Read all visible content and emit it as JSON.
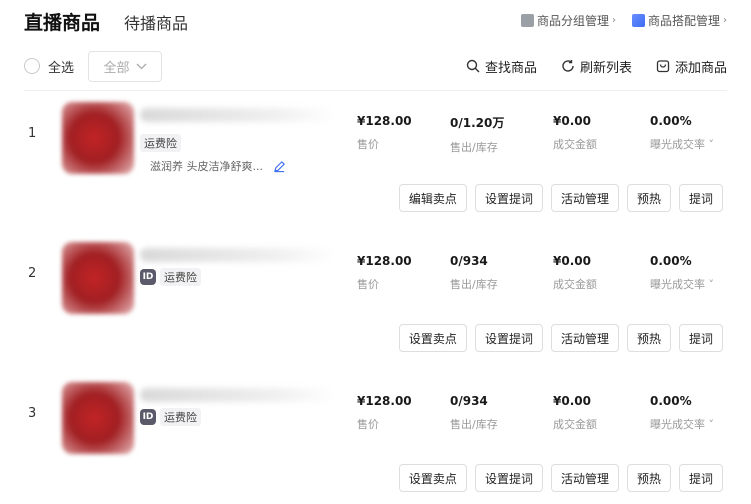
{
  "tabs": {
    "active": "直播商品",
    "inactive": "待播商品"
  },
  "top_links": {
    "group_manage": "商品分组管理",
    "match_manage": "商品搭配管理"
  },
  "toolbar": {
    "select_all": "全选",
    "filter_value": "全部",
    "find": "查找商品",
    "refresh": "刷新列表",
    "add": "添加商品"
  },
  "rows": [
    {
      "index": "1",
      "tag": "运费险",
      "desc": "滋润养 头皮洁净舒爽...",
      "price": "¥128.00",
      "price_label": "售价",
      "sold_stock": "0/1.20万",
      "sold_stock_label": "售出/库存",
      "gmv": "¥0.00",
      "gmv_label": "成交金额",
      "rate": "0.00%",
      "rate_label": "曝光成交率",
      "buttons": [
        "编辑卖点",
        "设置提词",
        "活动管理",
        "预热",
        "提词"
      ]
    },
    {
      "index": "2",
      "id_badge": "ID",
      "tag": "运费险",
      "price": "¥128.00",
      "price_label": "售价",
      "sold_stock": "0/934",
      "sold_stock_label": "售出/库存",
      "gmv": "¥0.00",
      "gmv_label": "成交金额",
      "rate": "0.00%",
      "rate_label": "曝光成交率",
      "buttons": [
        "设置卖点",
        "设置提词",
        "活动管理",
        "预热",
        "提词"
      ]
    },
    {
      "index": "3",
      "id_badge": "ID",
      "tag": "运费险",
      "price": "¥128.00",
      "price_label": "售价",
      "sold_stock": "0/934",
      "sold_stock_label": "售出/库存",
      "gmv": "¥0.00",
      "gmv_label": "成交金额",
      "rate": "0.00%",
      "rate_label": "曝光成交率",
      "buttons": [
        "设置卖点",
        "设置提词",
        "活动管理",
        "预热",
        "提词"
      ]
    }
  ]
}
